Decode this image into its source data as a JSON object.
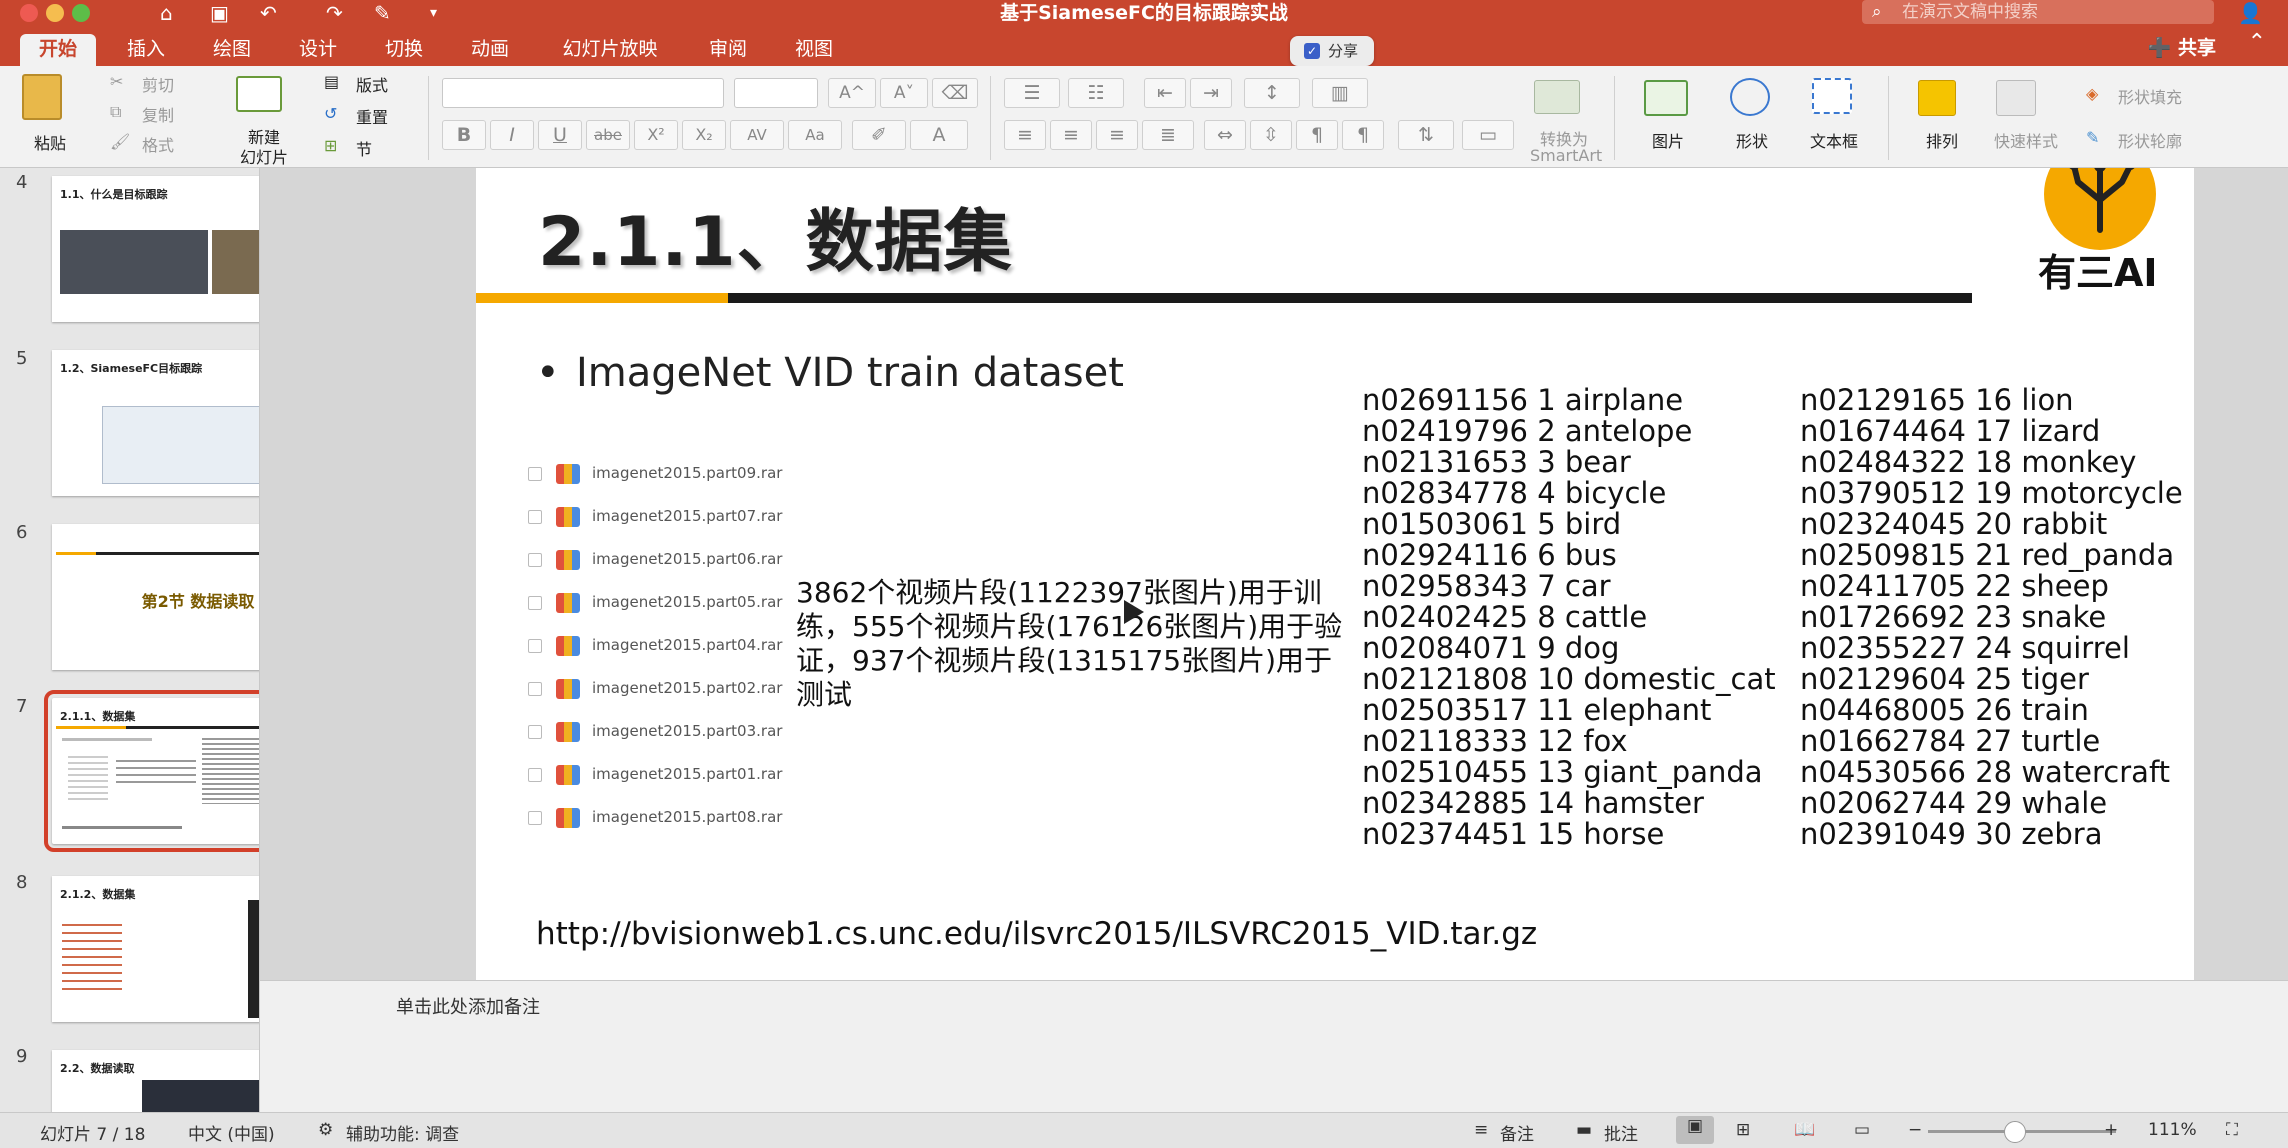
{
  "titlebar": {
    "doc_title": "基于SiameseFC的目标跟踪实战",
    "search_placeholder": "在演示文稿中搜索"
  },
  "tabs": [
    "开始",
    "插入",
    "绘图",
    "设计",
    "切换",
    "动画",
    "幻灯片放映",
    "审阅",
    "视图"
  ],
  "share": {
    "label": "共享",
    "popup_label": "分享"
  },
  "ribbon": {
    "paste": "粘贴",
    "cut": "剪切",
    "copy": "复制",
    "format": "格式",
    "new_slide_line1": "新建",
    "new_slide_line2": "幻灯片",
    "layout": "版式",
    "reset": "重置",
    "section": "节",
    "bold": "B",
    "italic": "I",
    "underline": "U",
    "strike": "abe",
    "superscript": "X²",
    "subscript": "X₂",
    "grow_font": "A^",
    "shrink_font": "A˅",
    "convert_line1": "转换为",
    "convert_line2": "SmartArt",
    "picture": "图片",
    "shape": "形状",
    "textbox": "文本框",
    "arrange": "排列",
    "quick_style": "快速样式",
    "shape_fill": "形状填充",
    "shape_outline": "形状轮廓"
  },
  "thumbnails": [
    {
      "num": "4",
      "title": "1.1、什么是目标跟踪"
    },
    {
      "num": "5",
      "title": "1.2、SiameseFC目标跟踪"
    },
    {
      "num": "6",
      "title": "第2节 数据读取"
    },
    {
      "num": "7",
      "title": "2.1.1、数据集"
    },
    {
      "num": "8",
      "title": "2.1.2、数据集"
    },
    {
      "num": "9",
      "title": "2.2、数据读取"
    }
  ],
  "slide": {
    "title": "2.1.1、数据集",
    "logo_text": "有三AI",
    "bullet": "ImageNet VID train dataset",
    "files": [
      "imagenet2015.part09.rar",
      "imagenet2015.part07.rar",
      "imagenet2015.part06.rar",
      "imagenet2015.part05.rar",
      "imagenet2015.part04.rar",
      "imagenet2015.part02.rar",
      "imagenet2015.part03.rar",
      "imagenet2015.part01.rar",
      "imagenet2015.part08.rar"
    ],
    "description": "3862个视频片段(1122397张图片)用于训练，555个视频片段(176126张图片)用于验证，937个视频片段(1315175张图片)用于测试",
    "classes_col1": [
      "n02691156 1 airplane",
      "n02419796 2 antelope",
      "n02131653 3 bear",
      "n02834778 4 bicycle",
      "n01503061 5 bird",
      "n02924116 6 bus",
      "n02958343 7 car",
      "n02402425 8 cattle",
      "n02084071 9 dog",
      "n02121808 10 domestic_cat",
      "n02503517 11 elephant",
      "n02118333 12 fox",
      "n02510455 13 giant_panda",
      "n02342885 14 hamster",
      "n02374451 15 horse"
    ],
    "classes_col2": [
      "n02129165 16 lion",
      "n01674464 17 lizard",
      "n02484322 18 monkey",
      "n03790512 19 motorcycle",
      "n02324045 20 rabbit",
      "n02509815 21 red_panda",
      "n02411705 22 sheep",
      "n01726692 23 snake",
      "n02355227 24 squirrel",
      "n02129604 25 tiger",
      "n04468005 26 train",
      "n01662784 27 turtle",
      "n04530566 28 watercraft",
      "n02062744 29 whale",
      "n02391049 30 zebra"
    ],
    "url": "http://bvisionweb1.cs.unc.edu/ilsvrc2015/ILSVRC2015_VID.tar.gz"
  },
  "notes": {
    "placeholder": "单击此处添加备注"
  },
  "status": {
    "slide_counter": "幻灯片 7 / 18",
    "language": "中文 (中国)",
    "accessibility": "辅助功能: 调查",
    "notes_btn": "备注",
    "comments_btn": "批注",
    "zoom": "111%"
  },
  "colors": {
    "accent": "#c8462e",
    "orange": "#f5a800"
  }
}
